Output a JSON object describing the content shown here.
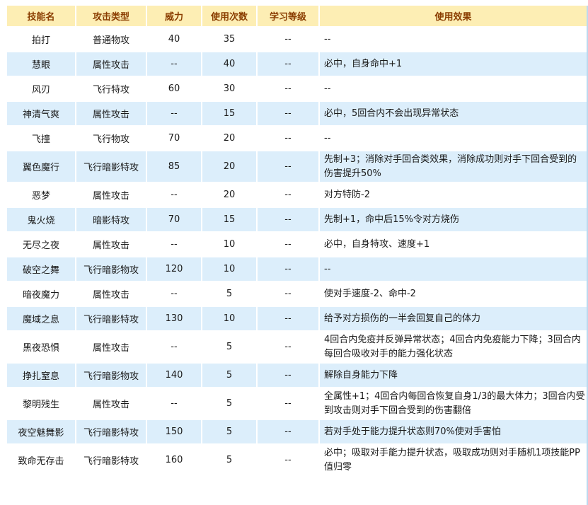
{
  "headers": [
    "技能名",
    "攻击类型",
    "威力",
    "使用次数",
    "学习等级",
    "使用效果"
  ],
  "rows": [
    {
      "name": "拍打",
      "type": "普通物攻",
      "power": "40",
      "pp": "35",
      "level": "--",
      "effect": "--"
    },
    {
      "name": "慧眼",
      "type": "属性攻击",
      "power": "--",
      "pp": "40",
      "level": "--",
      "effect": "必中，自身命中+1"
    },
    {
      "name": "风刃",
      "type": "飞行特攻",
      "power": "60",
      "pp": "30",
      "level": "--",
      "effect": "--"
    },
    {
      "name": "神清气爽",
      "type": "属性攻击",
      "power": "--",
      "pp": "15",
      "level": "--",
      "effect": "必中，5回合内不会出现异常状态"
    },
    {
      "name": "飞撞",
      "type": "飞行物攻",
      "power": "70",
      "pp": "20",
      "level": "--",
      "effect": "--"
    },
    {
      "name": "翼色魔行",
      "type": "飞行暗影特攻",
      "power": "85",
      "pp": "20",
      "level": "--",
      "effect": "先制+3；消除对手回合类效果，消除成功则对手下回合受到的伤害提升50%"
    },
    {
      "name": "恶梦",
      "type": "属性攻击",
      "power": "--",
      "pp": "20",
      "level": "--",
      "effect": "对方特防-2"
    },
    {
      "name": "鬼火烧",
      "type": "暗影特攻",
      "power": "70",
      "pp": "15",
      "level": "--",
      "effect": "先制+1，命中后15%令对方烧伤"
    },
    {
      "name": "无尽之夜",
      "type": "属性攻击",
      "power": "--",
      "pp": "10",
      "level": "--",
      "effect": "必中，自身特攻、速度+1"
    },
    {
      "name": "破空之舞",
      "type": "飞行暗影物攻",
      "power": "120",
      "pp": "10",
      "level": "--",
      "effect": "--"
    },
    {
      "name": "暗夜魔力",
      "type": "属性攻击",
      "power": "--",
      "pp": "5",
      "level": "--",
      "effect": "使对手速度-2、命中-2"
    },
    {
      "name": "魔域之息",
      "type": "飞行暗影特攻",
      "power": "130",
      "pp": "10",
      "level": "--",
      "effect": "给予对方损伤的一半会回复自己的体力"
    },
    {
      "name": "黑夜恐惧",
      "type": "属性攻击",
      "power": "--",
      "pp": "5",
      "level": "--",
      "effect": "4回合内免疫并反弹异常状态；4回合内免疫能力下降；3回合内每回合吸收对手的能力强化状态"
    },
    {
      "name": "挣扎窒息",
      "type": "飞行暗影物攻",
      "power": "140",
      "pp": "5",
      "level": "--",
      "effect": "解除自身能力下降"
    },
    {
      "name": "黎明残生",
      "type": "属性攻击",
      "power": "--",
      "pp": "5",
      "level": "--",
      "effect": "全属性+1；4回合内每回合恢复自身1/3的最大体力；3回合内受到攻击则对手下回合受到的伤害翻倍"
    },
    {
      "name": "夜空魅舞影",
      "type": "飞行暗影特攻",
      "power": "150",
      "pp": "5",
      "level": "--",
      "effect": "若对手处于能力提升状态则70%使对手害怕"
    },
    {
      "name": "致命无存击",
      "type": "飞行暗影特攻",
      "power": "160",
      "pp": "5",
      "level": "--",
      "effect": "必中；吸取对手能力提升状态，吸取成功则对手随机1项技能PP值归零"
    }
  ]
}
